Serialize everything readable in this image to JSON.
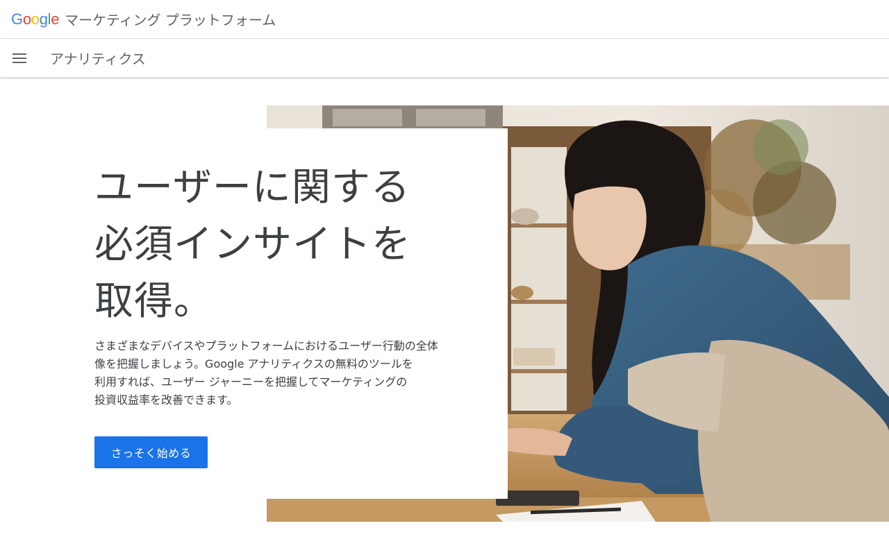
{
  "header": {
    "logo": {
      "letters": [
        "G",
        "o",
        "o",
        "g",
        "l",
        "e"
      ],
      "colors": [
        "#4285f4",
        "#ea4335",
        "#fbbc05",
        "#4285f4",
        "#34a853",
        "#ea4335"
      ]
    },
    "title": "マーケティング プラットフォーム"
  },
  "subheader": {
    "menu_icon": "hamburger-menu-icon",
    "product": "アナリティクス"
  },
  "hero": {
    "headline": [
      "ユーザーに関する",
      "必須インサイトを",
      "取得。"
    ],
    "body": [
      "さまざまなデバイスやプラットフォームにおけるユーザー行動の全体",
      "像を把握しましょう。Google アナリティクスの無料のツールを",
      "利用すれば、ユーザー ジャーニーを把握してマーケティングの",
      "投資収益率を改善できます。"
    ],
    "cta_label": "さっそく始める",
    "accent_color": "#1a73e8"
  }
}
